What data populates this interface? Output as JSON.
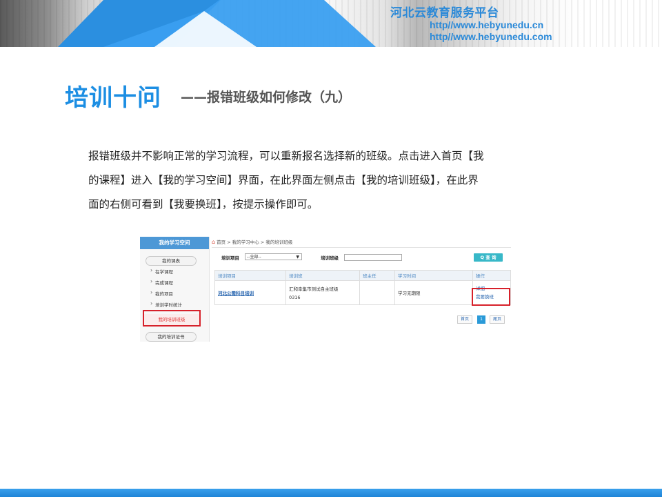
{
  "banner": {
    "brand": "河北云教育服务平台",
    "url1": "http//www.hebyunedu.cn",
    "url2": "http//www.hebyunedu.com"
  },
  "title": {
    "main": "培训十问",
    "sub": "——报错班级如何修改（九）"
  },
  "paragraph": {
    "line1": "报错班级并不影响正常的学习流程，可以重新报名选择新的班级。点击进入首页【我",
    "line2": "的课程】进入【我的学习空间】界面，在此界面左侧点击【我的培训班级】，在此界",
    "line3": "面的右侧可看到【我要换班】，按提示操作即可。"
  },
  "screenshot": {
    "sidebar": {
      "header": "我的学习空间",
      "courses": "我的课表",
      "items": [
        "在学课程",
        "完成课程",
        "我的项目",
        "培训学时统计"
      ],
      "active": "我的培训班级",
      "certificate": "我的培训证书"
    },
    "breadcrumb": "首页 > 我的学习中心 > 我的培训班级",
    "filter": {
      "project_label": "培训项目",
      "project_value": "--全部--",
      "class_label": "培训班级",
      "class_value": "",
      "search_button": "Q 查 询"
    },
    "table": {
      "headers": [
        "培训项目",
        "培训班",
        "班主任",
        "学习时间",
        "操作"
      ],
      "rows": [
        {
          "project": "河北公需科目培训",
          "class_line1": "汇和幸集市测试自主班级",
          "class_line2": "0316",
          "teacher": "",
          "time": "学习无期限",
          "op_details": "详细",
          "op_change": "我要换班"
        }
      ]
    },
    "pager": {
      "first": "首页",
      "current": "1",
      "last": "尾页"
    }
  },
  "colors": {
    "accent": "#1c8ee3",
    "brand_text": "#2a89d8",
    "highlight": "#d7202a"
  }
}
